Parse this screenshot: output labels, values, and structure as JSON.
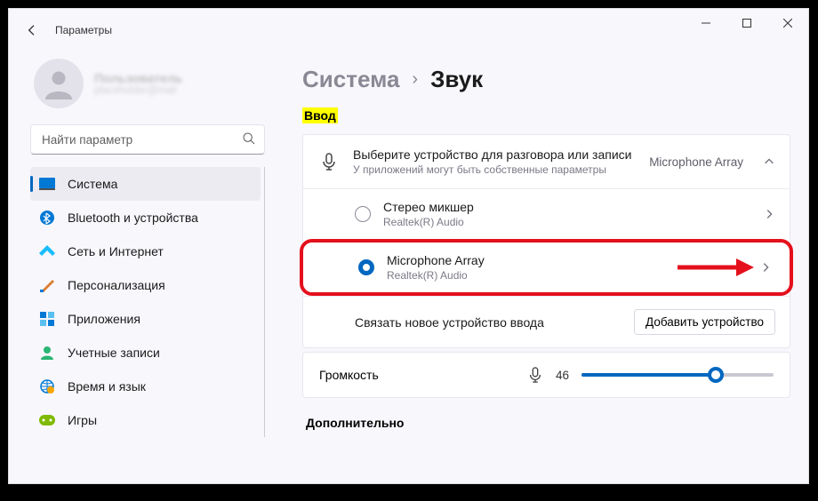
{
  "titlebar": {
    "title": "Параметры"
  },
  "user": {
    "name": "Пользователь",
    "email": "placeholder@mail"
  },
  "search": {
    "placeholder": "Найти параметр"
  },
  "nav": {
    "items": [
      {
        "label": "Система",
        "icon": "monitor",
        "active": true
      },
      {
        "label": "Bluetooth и устройства",
        "icon": "bluetooth"
      },
      {
        "label": "Сеть и Интернет",
        "icon": "wifi"
      },
      {
        "label": "Персонализация",
        "icon": "brush"
      },
      {
        "label": "Приложения",
        "icon": "apps"
      },
      {
        "label": "Учетные записи",
        "icon": "account"
      },
      {
        "label": "Время и язык",
        "icon": "globe"
      },
      {
        "label": "Игры",
        "icon": "game"
      }
    ]
  },
  "breadcrumb": {
    "parent": "Система",
    "current": "Звук"
  },
  "section": {
    "input_label": "Ввод",
    "advanced_label": "Дополнительно"
  },
  "input_device": {
    "title": "Выберите устройство для разговора или записи",
    "subtitle": "У приложений могут быть собственные параметры",
    "selected": "Microphone Array"
  },
  "devices": [
    {
      "name": "Стерео микшер",
      "driver": "Realtek(R) Audio",
      "checked": false
    },
    {
      "name": "Microphone Array",
      "driver": "Realtek(R) Audio",
      "checked": true
    }
  ],
  "pair": {
    "label": "Связать новое устройство ввода",
    "button": "Добавить устройство"
  },
  "volume": {
    "label": "Громкость",
    "value": 46
  }
}
